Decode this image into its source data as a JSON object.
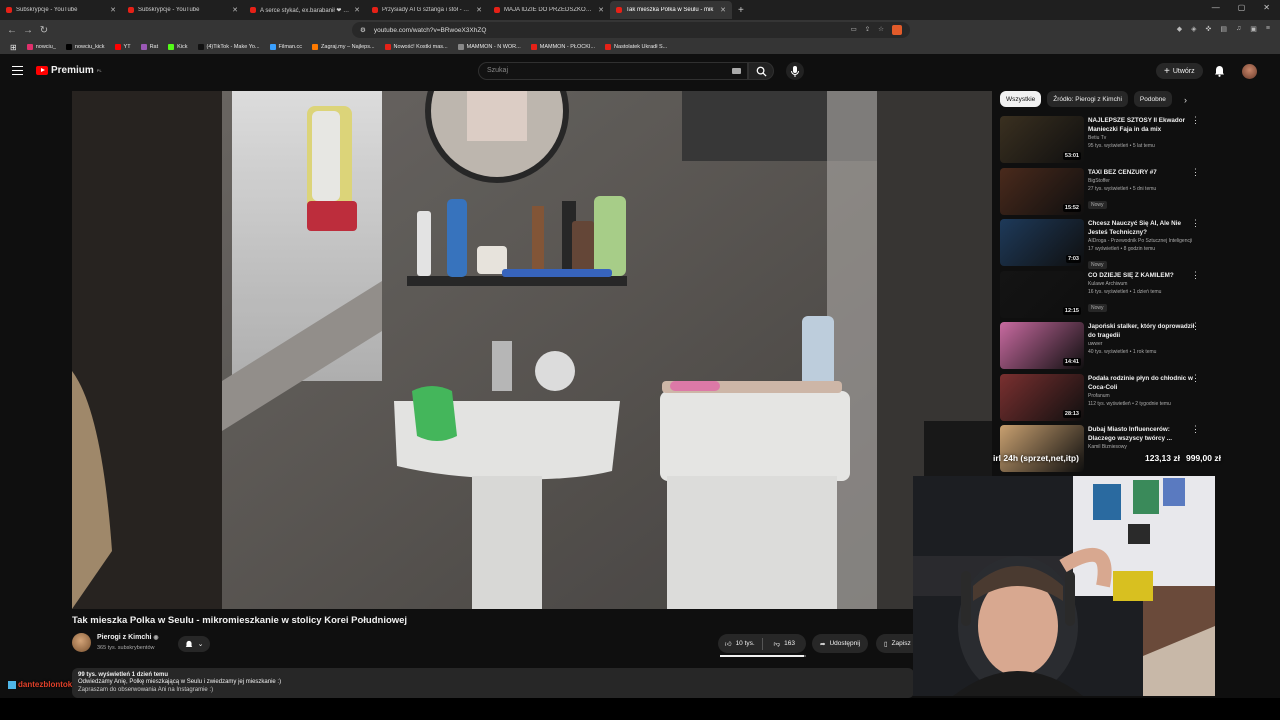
{
  "browser": {
    "tabs": [
      {
        "label": "Subskrypcje - YouTube",
        "active": false
      },
      {
        "label": "Subskrypcje - YouTube",
        "active": false
      },
      {
        "label": "A serce stykać, ex.barabanił ❤ Пе",
        "active": false
      },
      {
        "label": "Przysiady ATG sztanga i stół - YouTub",
        "active": false
      },
      {
        "label": "MAJA IDZIE DO PRZEDSZKOLA! - You",
        "active": false
      },
      {
        "label": "Tak mieszka Polka w Seulu - mik",
        "active": true
      }
    ],
    "url": "youtube.com/watch?v=BRwoeX3XhZQ",
    "bookmarks": [
      {
        "label": "nowciu_",
        "color": "#e1306c"
      },
      {
        "label": "nowciu_kick",
        "color": "#000000"
      },
      {
        "label": "YT",
        "color": "#ff0000"
      },
      {
        "label": "Rat",
        "color": "#9b59b6"
      },
      {
        "label": "Kick",
        "color": "#53fc18"
      },
      {
        "label": "(4)TikTok - Make Yo...",
        "color": "#111111"
      },
      {
        "label": "Filman.cc",
        "color": "#3aa0ff"
      },
      {
        "label": "Zagraj.my – Najleps...",
        "color": "#ff7a00"
      },
      {
        "label": "Nowość! Kostki mas...",
        "color": "#e62117"
      },
      {
        "label": "MAMMON - N WOR...",
        "color": "#888888"
      },
      {
        "label": "MAMMON - PŁOCKI...",
        "color": "#e62117"
      },
      {
        "label": "Nastolatek Ukradł S...",
        "color": "#e62117"
      }
    ]
  },
  "youtube": {
    "logo_label": "Premium",
    "logo_country": "PL",
    "search_placeholder": "Szukaj",
    "create_label": "Utwórz"
  },
  "video": {
    "title": "Tak mieszka Polka w Seulu - mikromieszkanie w stolicy Korei Południowej",
    "channel": "Pierogi z Kimchi",
    "subscribers": "365 tys. subskrybentów",
    "likes": "10 tys.",
    "dislikes": "163",
    "like_ratio": 0.98,
    "share_label": "Udostępnij",
    "save_label": "Zapisz",
    "views_meta": "99 tys. wyświetleń  1 dzień temu",
    "desc_line1": "Odwiedzamy Anię, Polkę mieszkającą w Seulu i zwiedzamy jej mieszkanie :)",
    "desc_line2": "Zapraszam do obserwowania Ani na Instagramie :)"
  },
  "sidebar": {
    "chips": [
      "Wszystkie",
      "Źródło: Pierogi z Kimchi",
      "Podobne"
    ],
    "recommendations": [
      {
        "title": "NAJLEPSZE SZTOSY II Ekwador Manieczki Faja in da mix",
        "channel": "Betiu Tv",
        "meta": "95 tys. wyświetleń • 5 lat temu",
        "duration": "53:01",
        "badge": "",
        "thumb": "#3a3020"
      },
      {
        "title": "TAXI BEZ CENZURY #7",
        "channel": "BigStoffer",
        "meta": "27 tys. wyświetleń • 5 dni temu",
        "duration": "15:52",
        "badge": "Nowy",
        "thumb": "#4a2a1c"
      },
      {
        "title": "Chcesz Nauczyć Się AI, Ale Nie Jesteś Techniczny?",
        "channel": "AIDroga - Przewodnik Po Sztucznej Inteligencji",
        "meta": "17 wyświetleń • 8 godzin temu",
        "duration": "7:03",
        "badge": "Nowy",
        "thumb": "#1e3a5a"
      },
      {
        "title": "CO DZIEJE SIĘ Z KAMILEM?",
        "channel": "Kulawe Archiwum",
        "meta": "16 tys. wyświetleń • 1 dzień temu",
        "duration": "12:15",
        "badge": "Nowy",
        "thumb": "#141414"
      },
      {
        "title": "Japoński stalker, który doprowadził do tragedii",
        "channel": "uwwer",
        "meta": "40 tys. wyświetleń • 1 rok temu",
        "duration": "14:41",
        "badge": "",
        "thumb": "#c86aa0"
      },
      {
        "title": "Podała rodzinie płyn do chłodnic w Coca-Coli",
        "channel": "Profanum",
        "meta": "112 tys. wyświetleń • 2 tygodnie temu",
        "duration": "28:13",
        "badge": "",
        "thumb": "#7a3030"
      },
      {
        "title": "Dubaj Miasto Influencerów: Dlaczego wszyscy twórcy ...",
        "channel": "Kamil Bizniesowy",
        "meta": "",
        "duration": "",
        "badge": "",
        "thumb": "#c8a070"
      }
    ]
  },
  "stream_overlay": {
    "username": "dantezblontok",
    "donation_text": "irl 24h (sprzet,net,itp)",
    "donation_current": "123,13 zł",
    "donation_target": "999,00 zł"
  }
}
